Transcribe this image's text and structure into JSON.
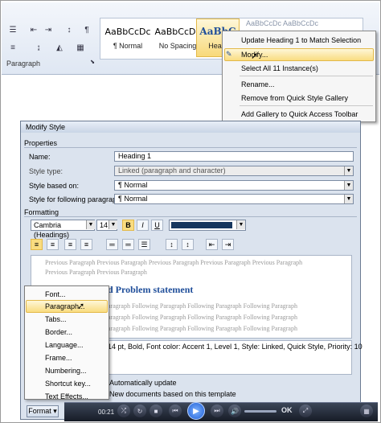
{
  "ribbon": {
    "group_label": "Paragraph",
    "styles": [
      {
        "sample": "AaBbCcDc",
        "name": "¶ Normal"
      },
      {
        "sample": "AaBbCcDc",
        "name": "No Spacing"
      },
      {
        "sample": "AaBbC",
        "name": "Headi"
      }
    ],
    "overflow_sample": "AaBbCcDc AaBbCcDc"
  },
  "context_menu": {
    "items": [
      "Update Heading 1 to Match Selection",
      "Modify...",
      "Select All 11 Instance(s)",
      "Rename...",
      "Remove from Quick Style Gallery",
      "Add Gallery to Quick Access Toolbar"
    ],
    "highlighted": "Modify..."
  },
  "dialog": {
    "title": "Modify Style",
    "properties_label": "Properties",
    "name_label": "Name:",
    "name_value": "Heading 1",
    "style_type_label": "Style type:",
    "style_type_value": "Linked (paragraph and character)",
    "based_on_label": "Style based on:",
    "based_on_value": "¶ Normal",
    "following_label": "Style for following paragraph:",
    "following_value": "¶ Normal",
    "formatting_label": "Formatting",
    "font_value": "Cambria (Headings)",
    "size_value": "14",
    "bold_label": "B",
    "italic_label": "I",
    "underline_label": "U",
    "font_color": "#17375e",
    "preview_previous": "Previous Paragraph Previous Paragraph Previous Paragraph Previous Paragraph Previous Paragraph",
    "preview_previous_short": "Previous Paragraph Previous Paragraph",
    "preview_heading": "d Problem statement",
    "preview_following": "aragraph Following Paragraph Following Paragraph Following Paragraph",
    "description": "14 pt, Bold, Font color: Accent 1, Level 1, Style: Linked, Quick Style, Priority: 10",
    "auto_update_label": "Automatically update",
    "new_docs_label": "New documents based on this template",
    "format_button": "Format ▾"
  },
  "format_menu": {
    "items": [
      "Font...",
      "Paragraph...",
      "Tabs...",
      "Border...",
      "Language...",
      "Frame...",
      "Numbering...",
      "Shortcut key...",
      "Text Effects..."
    ],
    "highlighted": "Paragraph..."
  },
  "player": {
    "time": "00:21",
    "ok_label": "OK"
  },
  "colors": {
    "heading_blue": "#1f4e9a",
    "menu_highlight": "#f9dc80"
  }
}
